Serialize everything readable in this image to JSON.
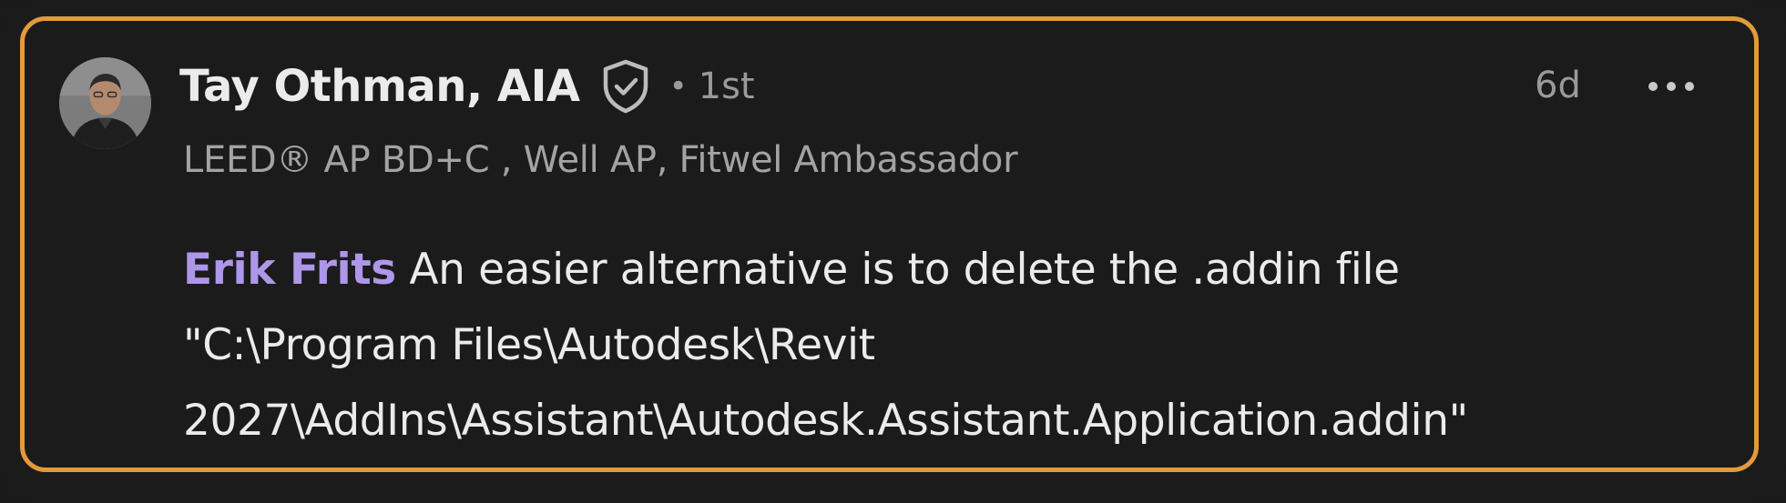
{
  "comment": {
    "author": {
      "name": "Tay Othman, AIA",
      "connection_separator": "•",
      "connection_degree": "1st",
      "headline": "LEED® AP BD+C , Well AP, Fitwel Ambassador",
      "avatar_icon": "profile-photo",
      "verified_icon": "verified-shield-icon"
    },
    "timestamp": "6d",
    "more_icon": "more-options-icon",
    "mention": "Erik Frits",
    "lines": [
      "An easier alternative is to delete the .addin file",
      "\"C:\\Program Files\\Autodesk\\Revit",
      "2027\\AddIns\\Assistant\\Autodesk.Assistant.Application.addin\""
    ]
  },
  "colors": {
    "background": "#1b1b1b",
    "highlight_border": "#e39a3b",
    "primary_text": "#ebebeb",
    "secondary_text": "#9a9a9a",
    "mention": "#ae96e8"
  }
}
